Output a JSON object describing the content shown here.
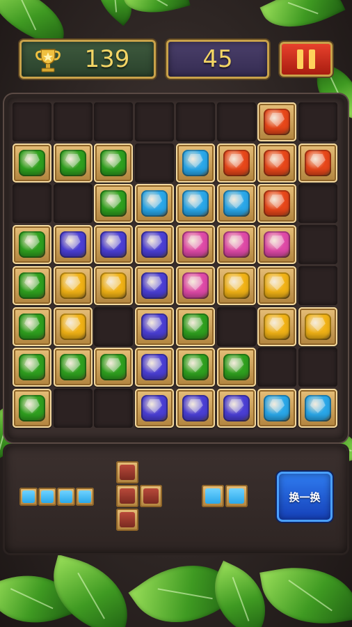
{
  "hud": {
    "best_score": "139",
    "current_score": "45"
  },
  "colors": {
    "green": "#2fa11f",
    "blue": "#2aa8ea",
    "orange": "#e8471a",
    "purple": "#4b3fd6",
    "pink": "#e04aa8",
    "yellow": "#f2b316"
  },
  "board": {
    "rows": [
      [
        "",
        "",
        "",
        "",
        "",
        "",
        "orange",
        ""
      ],
      [
        "green",
        "green",
        "green",
        "",
        "blue",
        "orange",
        "orange",
        "orange"
      ],
      [
        "",
        "",
        "green",
        "blue",
        "blue",
        "blue",
        "orange",
        ""
      ],
      [
        "green",
        "purple",
        "purple",
        "purple",
        "pink",
        "pink",
        "pink",
        ""
      ],
      [
        "green",
        "yellow",
        "yellow",
        "purple",
        "pink",
        "yellow",
        "yellow",
        ""
      ],
      [
        "green",
        "yellow",
        "",
        "purple",
        "green",
        "",
        "yellow",
        "yellow"
      ],
      [
        "green",
        "green",
        "green",
        "purple",
        "green",
        "green",
        "",
        ""
      ],
      [
        "green",
        "",
        "",
        "purple",
        "purple",
        "purple",
        "blue",
        "blue"
      ]
    ]
  },
  "tray": {
    "swap_label": "换一换",
    "piece_1": {
      "color": "blue",
      "count": 4
    },
    "piece_2": {
      "color": "red",
      "shape": "T-left"
    },
    "piece_3": {
      "color": "blue",
      "count": 2
    }
  }
}
